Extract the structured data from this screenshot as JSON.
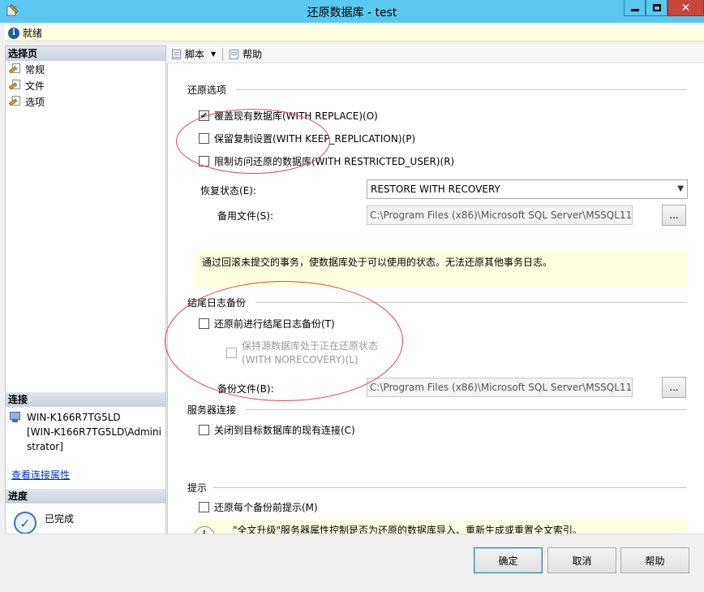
{
  "window": {
    "title": "还原数据库 - test",
    "close_glyph": "✕"
  },
  "status": {
    "text": "就绪",
    "icon": "info-icon"
  },
  "left": {
    "pages_header": "选择页",
    "pages": [
      {
        "label": "常规"
      },
      {
        "label": "文件"
      },
      {
        "label": "选项"
      }
    ],
    "connection_header": "连接",
    "connection_line1": "WIN-K166R7TG5LD",
    "connection_line2": "[WIN-K166R7TG5LD\\Admini",
    "connection_line3": "strator]",
    "connection_link": "查看连接属性",
    "progress_header": "进度",
    "progress_status": "已完成"
  },
  "toolbar": {
    "script_label": "脚本",
    "help_label": "帮助"
  },
  "restore_options": {
    "group_title": "还原选项",
    "overwrite": {
      "label": "覆盖现有数据库(WITH REPLACE)(O)",
      "checked": true
    },
    "keep_replication": {
      "label": "保留复制设置(WITH KEEP_REPLICATION)(P)",
      "checked": false
    },
    "restricted_user": {
      "label": "限制访问还原的数据库(WITH RESTRICTED_USER)(R)",
      "checked": false
    },
    "recovery_state_label": "恢复状态(E):",
    "recovery_state_value": "RESTORE WITH RECOVERY",
    "standby_file_label": "备用文件(S):",
    "standby_file_value": "C:\\Program Files (x86)\\Microsoft SQL Server\\MSSQL11.",
    "browse_label": "...",
    "description": "通过回滚未提交的事务，使数据库处于可以使用的状态。无法还原其他事务日志。"
  },
  "tail_log": {
    "group_title": "结尾日志备份",
    "take_tail_log": {
      "label": "还原前进行结尾日志备份(T)",
      "checked": false
    },
    "norecovery_line1": "保持源数据库处于正在还原状态",
    "norecovery_line2": "(WITH NORECOVERY)(L)",
    "backup_file_label": "备份文件(B):",
    "backup_file_value": "C:\\Program Files (x86)\\Microsoft SQL Server\\MSSQL11.",
    "browse_label": "..."
  },
  "server_connections": {
    "group_title": "服务器连接",
    "close_connections": {
      "label": "关闭到目标数据库的现有连接(C)",
      "checked": false
    }
  },
  "prompt": {
    "group_title": "提示",
    "prompt_each": {
      "label": "还原每个备份前提示(M)",
      "checked": false
    },
    "info_note": "\"全文升级\"服务器属性控制是否为还原的数据库导入、重新生成或重置全文索引。"
  },
  "buttons": {
    "ok": "确定",
    "cancel": "取消",
    "help": "帮助"
  },
  "colors": {
    "titlebar": "#5ac8f0",
    "annotation_circle": "#e04545",
    "note_bg": "#ffffe1"
  }
}
